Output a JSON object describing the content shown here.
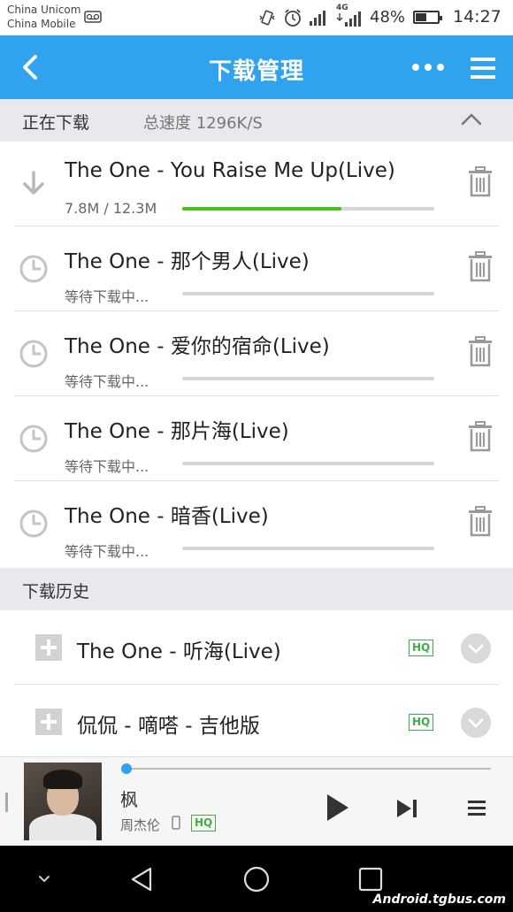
{
  "status_bar": {
    "carrier_1": "China Unicom",
    "carrier_2": "China Mobile",
    "battery": "48%",
    "time": "14:27",
    "network_label": "4G"
  },
  "app_bar": {
    "title": "下载管理",
    "back_icon": "chevron-left-icon",
    "more_icon": "more-horizontal-icon",
    "menu_icon": "hamburger-menu-icon"
  },
  "downloading": {
    "header": "正在下载",
    "speed": "总速度 1296K/S",
    "items": [
      {
        "title": "The One - You Raise Me Up(Live)",
        "status": "7.8M / 12.3M",
        "progress": 0.63,
        "state": "downloading"
      },
      {
        "title": "The One - 那个男人(Live)",
        "status": "等待下载中...",
        "progress": 0,
        "state": "waiting"
      },
      {
        "title": "The One - 爱你的宿命(Live)",
        "status": "等待下载中...",
        "progress": 0,
        "state": "waiting"
      },
      {
        "title": "The One - 那片海(Live)",
        "status": "等待下载中...",
        "progress": 0,
        "state": "waiting"
      },
      {
        "title": "The One - 暗香(Live)",
        "status": "等待下载中...",
        "progress": 0,
        "state": "waiting"
      }
    ]
  },
  "history": {
    "header": "下载历史",
    "items": [
      {
        "title": "The One - 听海(Live)",
        "badge": "HQ"
      },
      {
        "title": "侃侃 - 嘀嗒 - 吉他版",
        "badge": "HQ"
      }
    ]
  },
  "player": {
    "song": "枫",
    "artist": "周杰伦",
    "badge": "HQ",
    "progress": 0.01
  },
  "watermark": "Android.tgbus.com",
  "colors": {
    "accent": "#2fa3ee",
    "progress_green": "#46c21e",
    "hq_green": "#3fae46"
  }
}
